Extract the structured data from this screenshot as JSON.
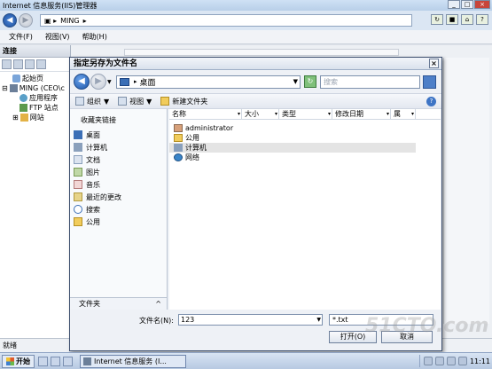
{
  "iis": {
    "title": "Internet 信息服务(IIS)管理器",
    "address_item": "MING",
    "menu": [
      "文件(F)",
      "视图(V)",
      "帮助(H)"
    ],
    "connections_title": "连接",
    "tree": [
      "起始页",
      "MING (CEO\\c",
      "应用程序",
      "FTP 站点",
      "网站"
    ],
    "status": "就绪"
  },
  "dialog": {
    "title": "指定另存为文件名",
    "location": "桌面",
    "search_placeholder": "搜索",
    "toolbar": {
      "organize": "组织",
      "views": "视图",
      "new_folder": "新建文件夹"
    },
    "favorites_header": "收藏夹链接",
    "favorites": [
      "桌面",
      "计算机",
      "文档",
      "图片",
      "音乐",
      "最近的更改",
      "搜索",
      "公用"
    ],
    "folders_label": "文件夹",
    "columns": [
      "名称",
      "大小",
      "类型",
      "修改日期",
      "属"
    ],
    "files": [
      "administrator",
      "公用",
      "计算机",
      "网络"
    ],
    "filename_label": "文件名(N):",
    "filename_value": "123",
    "filter_value": "*.txt",
    "open_button": "打开(O)",
    "cancel_button": "取消"
  },
  "taskbar": {
    "start": "开始",
    "task_item": "Internet 信息服务 (I...",
    "clock": "11:11"
  },
  "watermark": "51CTO.com"
}
